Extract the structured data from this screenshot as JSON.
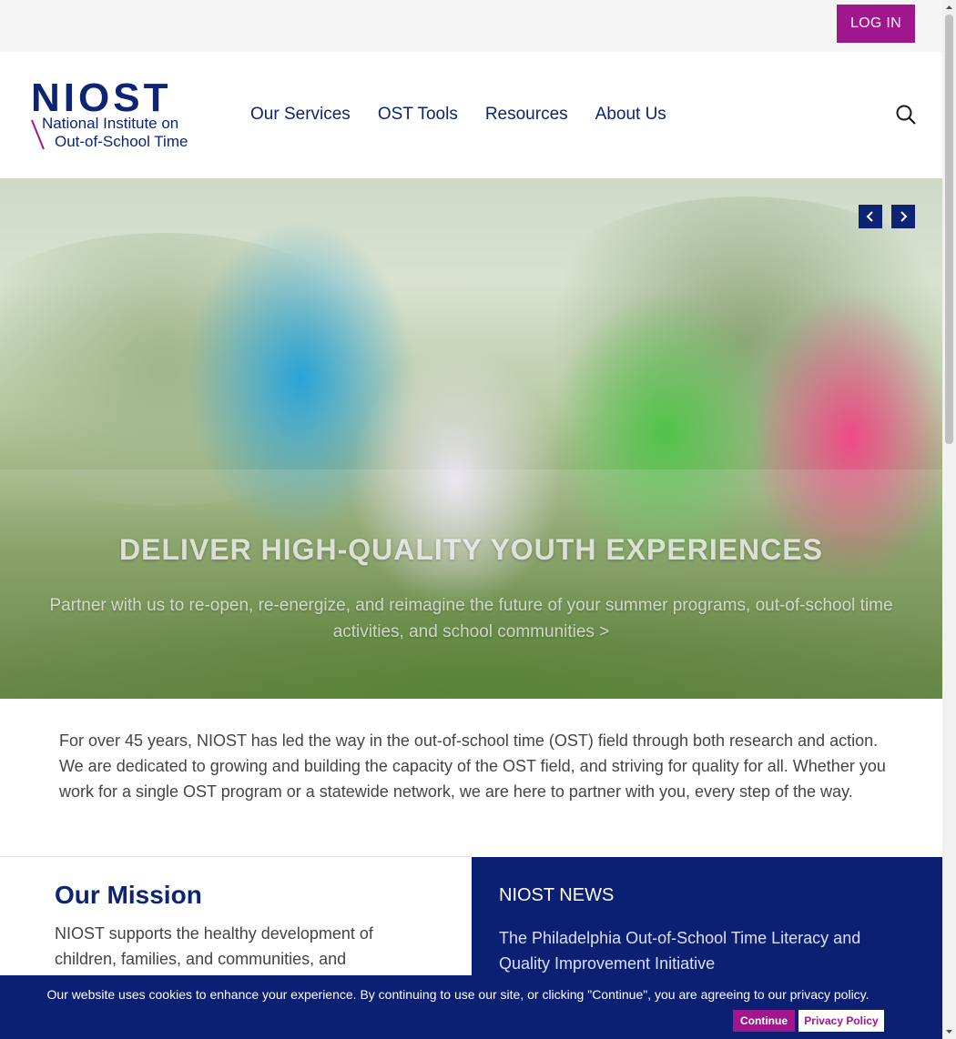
{
  "topbar": {
    "login_label": "LOG IN"
  },
  "logo": {
    "main": "NIOST",
    "line1": "National Institute on",
    "line2": "Out-of-School Time"
  },
  "nav": {
    "items": [
      "Our Services",
      "OST Tools",
      "Resources",
      "About Us"
    ]
  },
  "hero": {
    "title": "DELIVER HIGH-QUALITY YOUTH EXPERIENCES",
    "subtitle": "Partner with us to re-open, re-energize, and reimagine the future of your summer programs, out-of-school time activities, and school communities >",
    "prev_icon": "chevron-left-icon",
    "next_icon": "chevron-right-icon"
  },
  "intro": {
    "text": "For over 45 years, NIOST has led the way in the out-of-school time (OST) field through both research and action. We are dedicated to growing and building the capacity of the OST field, and striving for quality for all. Whether you work for a single OST program or a statewide network, we are here to partner with you, every step of the way."
  },
  "mission": {
    "title": "Our Mission",
    "text": "NIOST supports the healthy development of children, families, and communities, and"
  },
  "news": {
    "title": "NIOST NEWS",
    "item": "The Philadelphia Out-of-School Time Literacy and Quality Improvement Initiative"
  },
  "cookie": {
    "text": "Our website uses cookies to enhance your experience. By continuing to use our site, or clicking \"Continue\", you are agreeing to our privacy policy.",
    "continue_label": "Continue",
    "privacy_label": "Privacy Policy"
  },
  "colors": {
    "brand_navy": "#0d2475",
    "accent_magenta": "#a0168c"
  }
}
